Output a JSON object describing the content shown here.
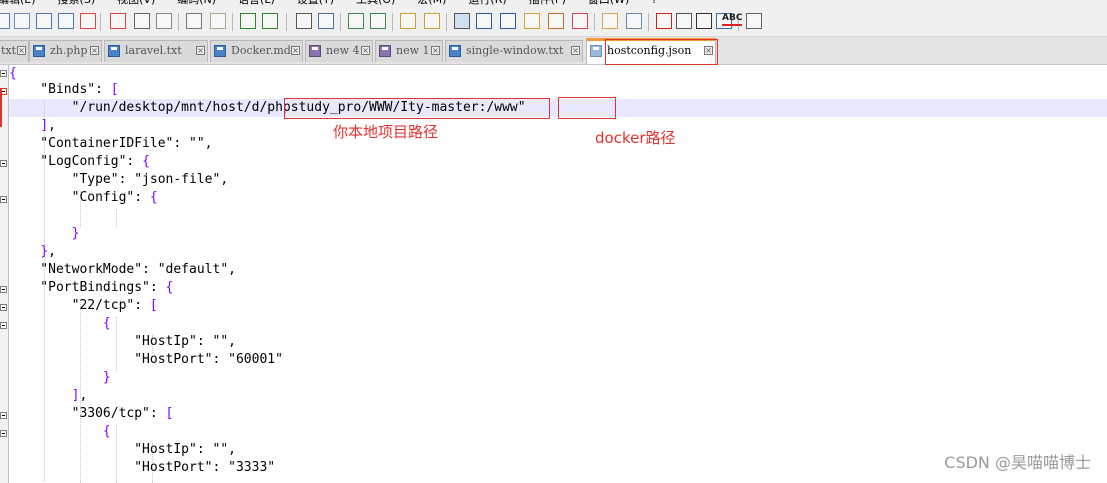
{
  "menu": [
    "编辑(E)",
    "搜索(S)",
    "视图(V)",
    "编码(N)",
    "语言(L)",
    "设置(T)",
    "工具(O)",
    "宏(M)",
    "运行(R)",
    "插件(P)",
    "窗口(W)",
    "?"
  ],
  "toolbar": {
    "icons": [
      "new-file-icon",
      "open-file-icon",
      "save-icon",
      "save-all-icon",
      "close-icon",
      "close-all-icon",
      "print-icon",
      "cut-icon",
      "copy-icon",
      "paste-icon",
      "undo-icon",
      "redo-icon",
      "find-icon",
      "replace-icon",
      "zoom-in-icon",
      "zoom-out-icon",
      "sync-vertical-icon",
      "sync-horizontal-icon",
      "word-wrap-icon",
      "show-all-chars-icon",
      "indent-guide-icon",
      "user-lang-icon",
      "doc-map-icon",
      "function-list-icon",
      "folder-workspace-icon",
      "monitoring-icon",
      "record-macro-icon",
      "stop-macro-icon",
      "play-macro-icon",
      "run-macro-multiple-icon",
      "save-macro-icon",
      "spell-check-icon"
    ],
    "spell_label": "ABC"
  },
  "tabs": [
    {
      "label": "txt"
    },
    {
      "label": "zh.php"
    },
    {
      "label": "laravel.txt"
    },
    {
      "label": "Docker.md"
    },
    {
      "label": "new 4"
    },
    {
      "label": "new 1"
    },
    {
      "label": "single-window.txt"
    },
    {
      "label": "hostconfig.json"
    }
  ],
  "close_glyph": "×",
  "code": {
    "l1": "{",
    "l2a": "    \"Binds\": ",
    "l2b": "[",
    "l3": "        \"/run/desktop/mnt/host/d/phpstudy_pro/WWW/Ity-master:/www\"",
    "l4a": "    ",
    "l4b": "]",
    "l4c": ",",
    "l5": "    \"ContainerIDFile\": \"\",",
    "l6a": "    \"LogConfig\": ",
    "l6b": "{",
    "l7": "        \"Type\": \"json-file\",",
    "l8a": "        \"Config\": ",
    "l8b": "{",
    "l9": "",
    "l10a": "        ",
    "l10b": "}",
    "l11a": "    ",
    "l11b": "}",
    "l11c": ",",
    "l12": "    \"NetworkMode\": \"default\",",
    "l13a": "    \"PortBindings\": ",
    "l13b": "{",
    "l14a": "        \"22/tcp\": ",
    "l14b": "[",
    "l15": "            {",
    "l16": "                \"HostIp\": \"\",",
    "l17": "                \"HostPort\": \"60001\"",
    "l18": "            }",
    "l19a": "        ",
    "l19b": "]",
    "l19c": ",",
    "l20a": "        \"3306/tcp\": ",
    "l20b": "[",
    "l21": "            {",
    "l22": "                \"HostIp\": \"\",",
    "l23": "                \"HostPort\": \"3333\""
  },
  "annotations": {
    "local_path": "你本地项目路径",
    "docker_path": "docker路径"
  },
  "watermark": "CSDN @昊喵喵博士",
  "colors": {
    "accent_red": "#e5322d",
    "active_tab_top": "#f29a38",
    "bracket": "#7f00ff",
    "current_line": "#e8e8ff"
  }
}
